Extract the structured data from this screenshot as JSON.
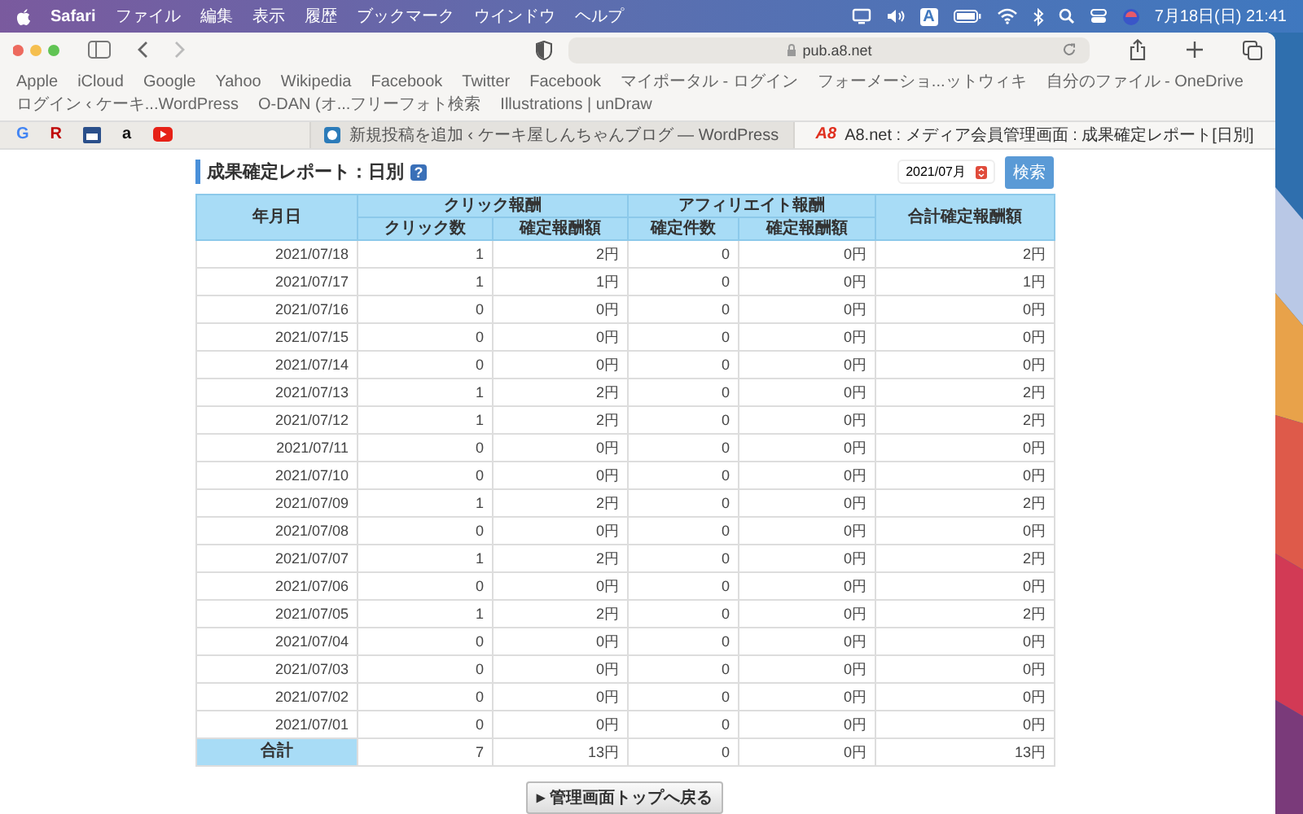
{
  "menu_bar": {
    "app": "Safari",
    "items": [
      "ファイル",
      "編集",
      "表示",
      "履歴",
      "ブックマーク",
      "ウインドウ",
      "ヘルプ"
    ],
    "input_mode": "A",
    "clock": "7月18日(日) 21:41"
  },
  "toolbar": {
    "url": "pub.a8.net"
  },
  "bookmarks": [
    "Apple",
    "iCloud",
    "Google",
    "Yahoo",
    "Wikipedia",
    "Facebook",
    "Twitter",
    "Facebook",
    "マイポータル - ログイン",
    "フォーメーショ...ットウィキ",
    "自分のファイル - OneDrive",
    "ログイン ‹ ケーキ...WordPress",
    "O-DAN (オ...フリーフォト検索",
    "Illustrations | unDraw"
  ],
  "pinned_tabs": [
    {
      "kind": "letter",
      "glyph": "G",
      "color": "#4285f4"
    },
    {
      "kind": "letter",
      "glyph": "R",
      "color": "#bf0000"
    },
    {
      "kind": "calendar",
      "color": "#2a4f8a"
    },
    {
      "kind": "letter",
      "glyph": "a",
      "color": "#111111"
    },
    {
      "kind": "play",
      "color": "#e62117"
    }
  ],
  "tabs": [
    {
      "title": "新規投稿を追加 ‹ ケーキ屋しんちゃんブログ — WordPress",
      "selected": false
    },
    {
      "title": "A8.net : メディア会員管理画面 : 成果確定レポート[日別]",
      "logo": "A8",
      "selected": true
    }
  ],
  "report": {
    "title": "成果確定レポート：日別",
    "help": "?",
    "month": "2021/07月",
    "search_button": "検索",
    "table": {
      "date_header": "年月日",
      "group_headers": [
        "クリック報酬",
        "アフィリエイト報酬"
      ],
      "total_header": "合計確定報酬額",
      "sub_headers": [
        "クリック数",
        "確定報酬額",
        "確定件数",
        "確定報酬額"
      ],
      "rows": [
        [
          "2021/07/18",
          "1",
          "2円",
          "0",
          "0円",
          "2円"
        ],
        [
          "2021/07/17",
          "1",
          "1円",
          "0",
          "0円",
          "1円"
        ],
        [
          "2021/07/16",
          "0",
          "0円",
          "0",
          "0円",
          "0円"
        ],
        [
          "2021/07/15",
          "0",
          "0円",
          "0",
          "0円",
          "0円"
        ],
        [
          "2021/07/14",
          "0",
          "0円",
          "0",
          "0円",
          "0円"
        ],
        [
          "2021/07/13",
          "1",
          "2円",
          "0",
          "0円",
          "2円"
        ],
        [
          "2021/07/12",
          "1",
          "2円",
          "0",
          "0円",
          "2円"
        ],
        [
          "2021/07/11",
          "0",
          "0円",
          "0",
          "0円",
          "0円"
        ],
        [
          "2021/07/10",
          "0",
          "0円",
          "0",
          "0円",
          "0円"
        ],
        [
          "2021/07/09",
          "1",
          "2円",
          "0",
          "0円",
          "2円"
        ],
        [
          "2021/07/08",
          "0",
          "0円",
          "0",
          "0円",
          "0円"
        ],
        [
          "2021/07/07",
          "1",
          "2円",
          "0",
          "0円",
          "2円"
        ],
        [
          "2021/07/06",
          "0",
          "0円",
          "0",
          "0円",
          "0円"
        ],
        [
          "2021/07/05",
          "1",
          "2円",
          "0",
          "0円",
          "2円"
        ],
        [
          "2021/07/04",
          "0",
          "0円",
          "0",
          "0円",
          "0円"
        ],
        [
          "2021/07/03",
          "0",
          "0円",
          "0",
          "0円",
          "0円"
        ],
        [
          "2021/07/02",
          "0",
          "0円",
          "0",
          "0円",
          "0円"
        ],
        [
          "2021/07/01",
          "0",
          "0円",
          "0",
          "0円",
          "0円"
        ]
      ],
      "total": [
        "合計",
        "7",
        "13円",
        "0",
        "0円",
        "13円"
      ]
    },
    "back_button": "▸ 管理画面トップへ戻る"
  }
}
